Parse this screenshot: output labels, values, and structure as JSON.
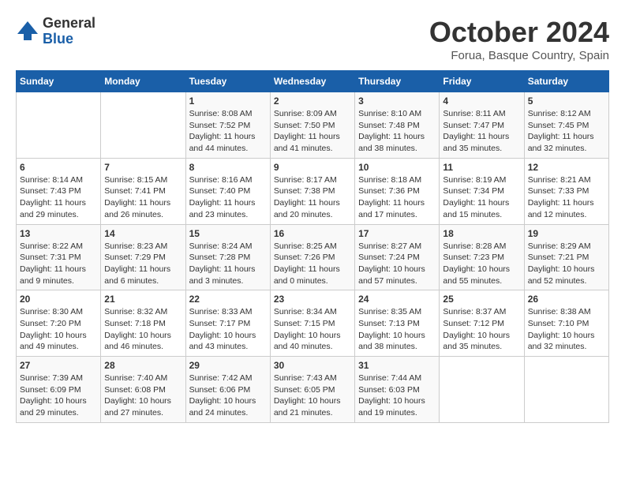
{
  "header": {
    "logo": {
      "general": "General",
      "blue": "Blue"
    },
    "title": "October 2024",
    "location": "Forua, Basque Country, Spain"
  },
  "weekdays": [
    "Sunday",
    "Monday",
    "Tuesday",
    "Wednesday",
    "Thursday",
    "Friday",
    "Saturday"
  ],
  "weeks": [
    [
      {
        "day": "",
        "detail": ""
      },
      {
        "day": "",
        "detail": ""
      },
      {
        "day": "1",
        "detail": "Sunrise: 8:08 AM\nSunset: 7:52 PM\nDaylight: 11 hours and 44 minutes."
      },
      {
        "day": "2",
        "detail": "Sunrise: 8:09 AM\nSunset: 7:50 PM\nDaylight: 11 hours and 41 minutes."
      },
      {
        "day": "3",
        "detail": "Sunrise: 8:10 AM\nSunset: 7:48 PM\nDaylight: 11 hours and 38 minutes."
      },
      {
        "day": "4",
        "detail": "Sunrise: 8:11 AM\nSunset: 7:47 PM\nDaylight: 11 hours and 35 minutes."
      },
      {
        "day": "5",
        "detail": "Sunrise: 8:12 AM\nSunset: 7:45 PM\nDaylight: 11 hours and 32 minutes."
      }
    ],
    [
      {
        "day": "6",
        "detail": "Sunrise: 8:14 AM\nSunset: 7:43 PM\nDaylight: 11 hours and 29 minutes."
      },
      {
        "day": "7",
        "detail": "Sunrise: 8:15 AM\nSunset: 7:41 PM\nDaylight: 11 hours and 26 minutes."
      },
      {
        "day": "8",
        "detail": "Sunrise: 8:16 AM\nSunset: 7:40 PM\nDaylight: 11 hours and 23 minutes."
      },
      {
        "day": "9",
        "detail": "Sunrise: 8:17 AM\nSunset: 7:38 PM\nDaylight: 11 hours and 20 minutes."
      },
      {
        "day": "10",
        "detail": "Sunrise: 8:18 AM\nSunset: 7:36 PM\nDaylight: 11 hours and 17 minutes."
      },
      {
        "day": "11",
        "detail": "Sunrise: 8:19 AM\nSunset: 7:34 PM\nDaylight: 11 hours and 15 minutes."
      },
      {
        "day": "12",
        "detail": "Sunrise: 8:21 AM\nSunset: 7:33 PM\nDaylight: 11 hours and 12 minutes."
      }
    ],
    [
      {
        "day": "13",
        "detail": "Sunrise: 8:22 AM\nSunset: 7:31 PM\nDaylight: 11 hours and 9 minutes."
      },
      {
        "day": "14",
        "detail": "Sunrise: 8:23 AM\nSunset: 7:29 PM\nDaylight: 11 hours and 6 minutes."
      },
      {
        "day": "15",
        "detail": "Sunrise: 8:24 AM\nSunset: 7:28 PM\nDaylight: 11 hours and 3 minutes."
      },
      {
        "day": "16",
        "detail": "Sunrise: 8:25 AM\nSunset: 7:26 PM\nDaylight: 11 hours and 0 minutes."
      },
      {
        "day": "17",
        "detail": "Sunrise: 8:27 AM\nSunset: 7:24 PM\nDaylight: 10 hours and 57 minutes."
      },
      {
        "day": "18",
        "detail": "Sunrise: 8:28 AM\nSunset: 7:23 PM\nDaylight: 10 hours and 55 minutes."
      },
      {
        "day": "19",
        "detail": "Sunrise: 8:29 AM\nSunset: 7:21 PM\nDaylight: 10 hours and 52 minutes."
      }
    ],
    [
      {
        "day": "20",
        "detail": "Sunrise: 8:30 AM\nSunset: 7:20 PM\nDaylight: 10 hours and 49 minutes."
      },
      {
        "day": "21",
        "detail": "Sunrise: 8:32 AM\nSunset: 7:18 PM\nDaylight: 10 hours and 46 minutes."
      },
      {
        "day": "22",
        "detail": "Sunrise: 8:33 AM\nSunset: 7:17 PM\nDaylight: 10 hours and 43 minutes."
      },
      {
        "day": "23",
        "detail": "Sunrise: 8:34 AM\nSunset: 7:15 PM\nDaylight: 10 hours and 40 minutes."
      },
      {
        "day": "24",
        "detail": "Sunrise: 8:35 AM\nSunset: 7:13 PM\nDaylight: 10 hours and 38 minutes."
      },
      {
        "day": "25",
        "detail": "Sunrise: 8:37 AM\nSunset: 7:12 PM\nDaylight: 10 hours and 35 minutes."
      },
      {
        "day": "26",
        "detail": "Sunrise: 8:38 AM\nSunset: 7:10 PM\nDaylight: 10 hours and 32 minutes."
      }
    ],
    [
      {
        "day": "27",
        "detail": "Sunrise: 7:39 AM\nSunset: 6:09 PM\nDaylight: 10 hours and 29 minutes."
      },
      {
        "day": "28",
        "detail": "Sunrise: 7:40 AM\nSunset: 6:08 PM\nDaylight: 10 hours and 27 minutes."
      },
      {
        "day": "29",
        "detail": "Sunrise: 7:42 AM\nSunset: 6:06 PM\nDaylight: 10 hours and 24 minutes."
      },
      {
        "day": "30",
        "detail": "Sunrise: 7:43 AM\nSunset: 6:05 PM\nDaylight: 10 hours and 21 minutes."
      },
      {
        "day": "31",
        "detail": "Sunrise: 7:44 AM\nSunset: 6:03 PM\nDaylight: 10 hours and 19 minutes."
      },
      {
        "day": "",
        "detail": ""
      },
      {
        "day": "",
        "detail": ""
      }
    ]
  ]
}
